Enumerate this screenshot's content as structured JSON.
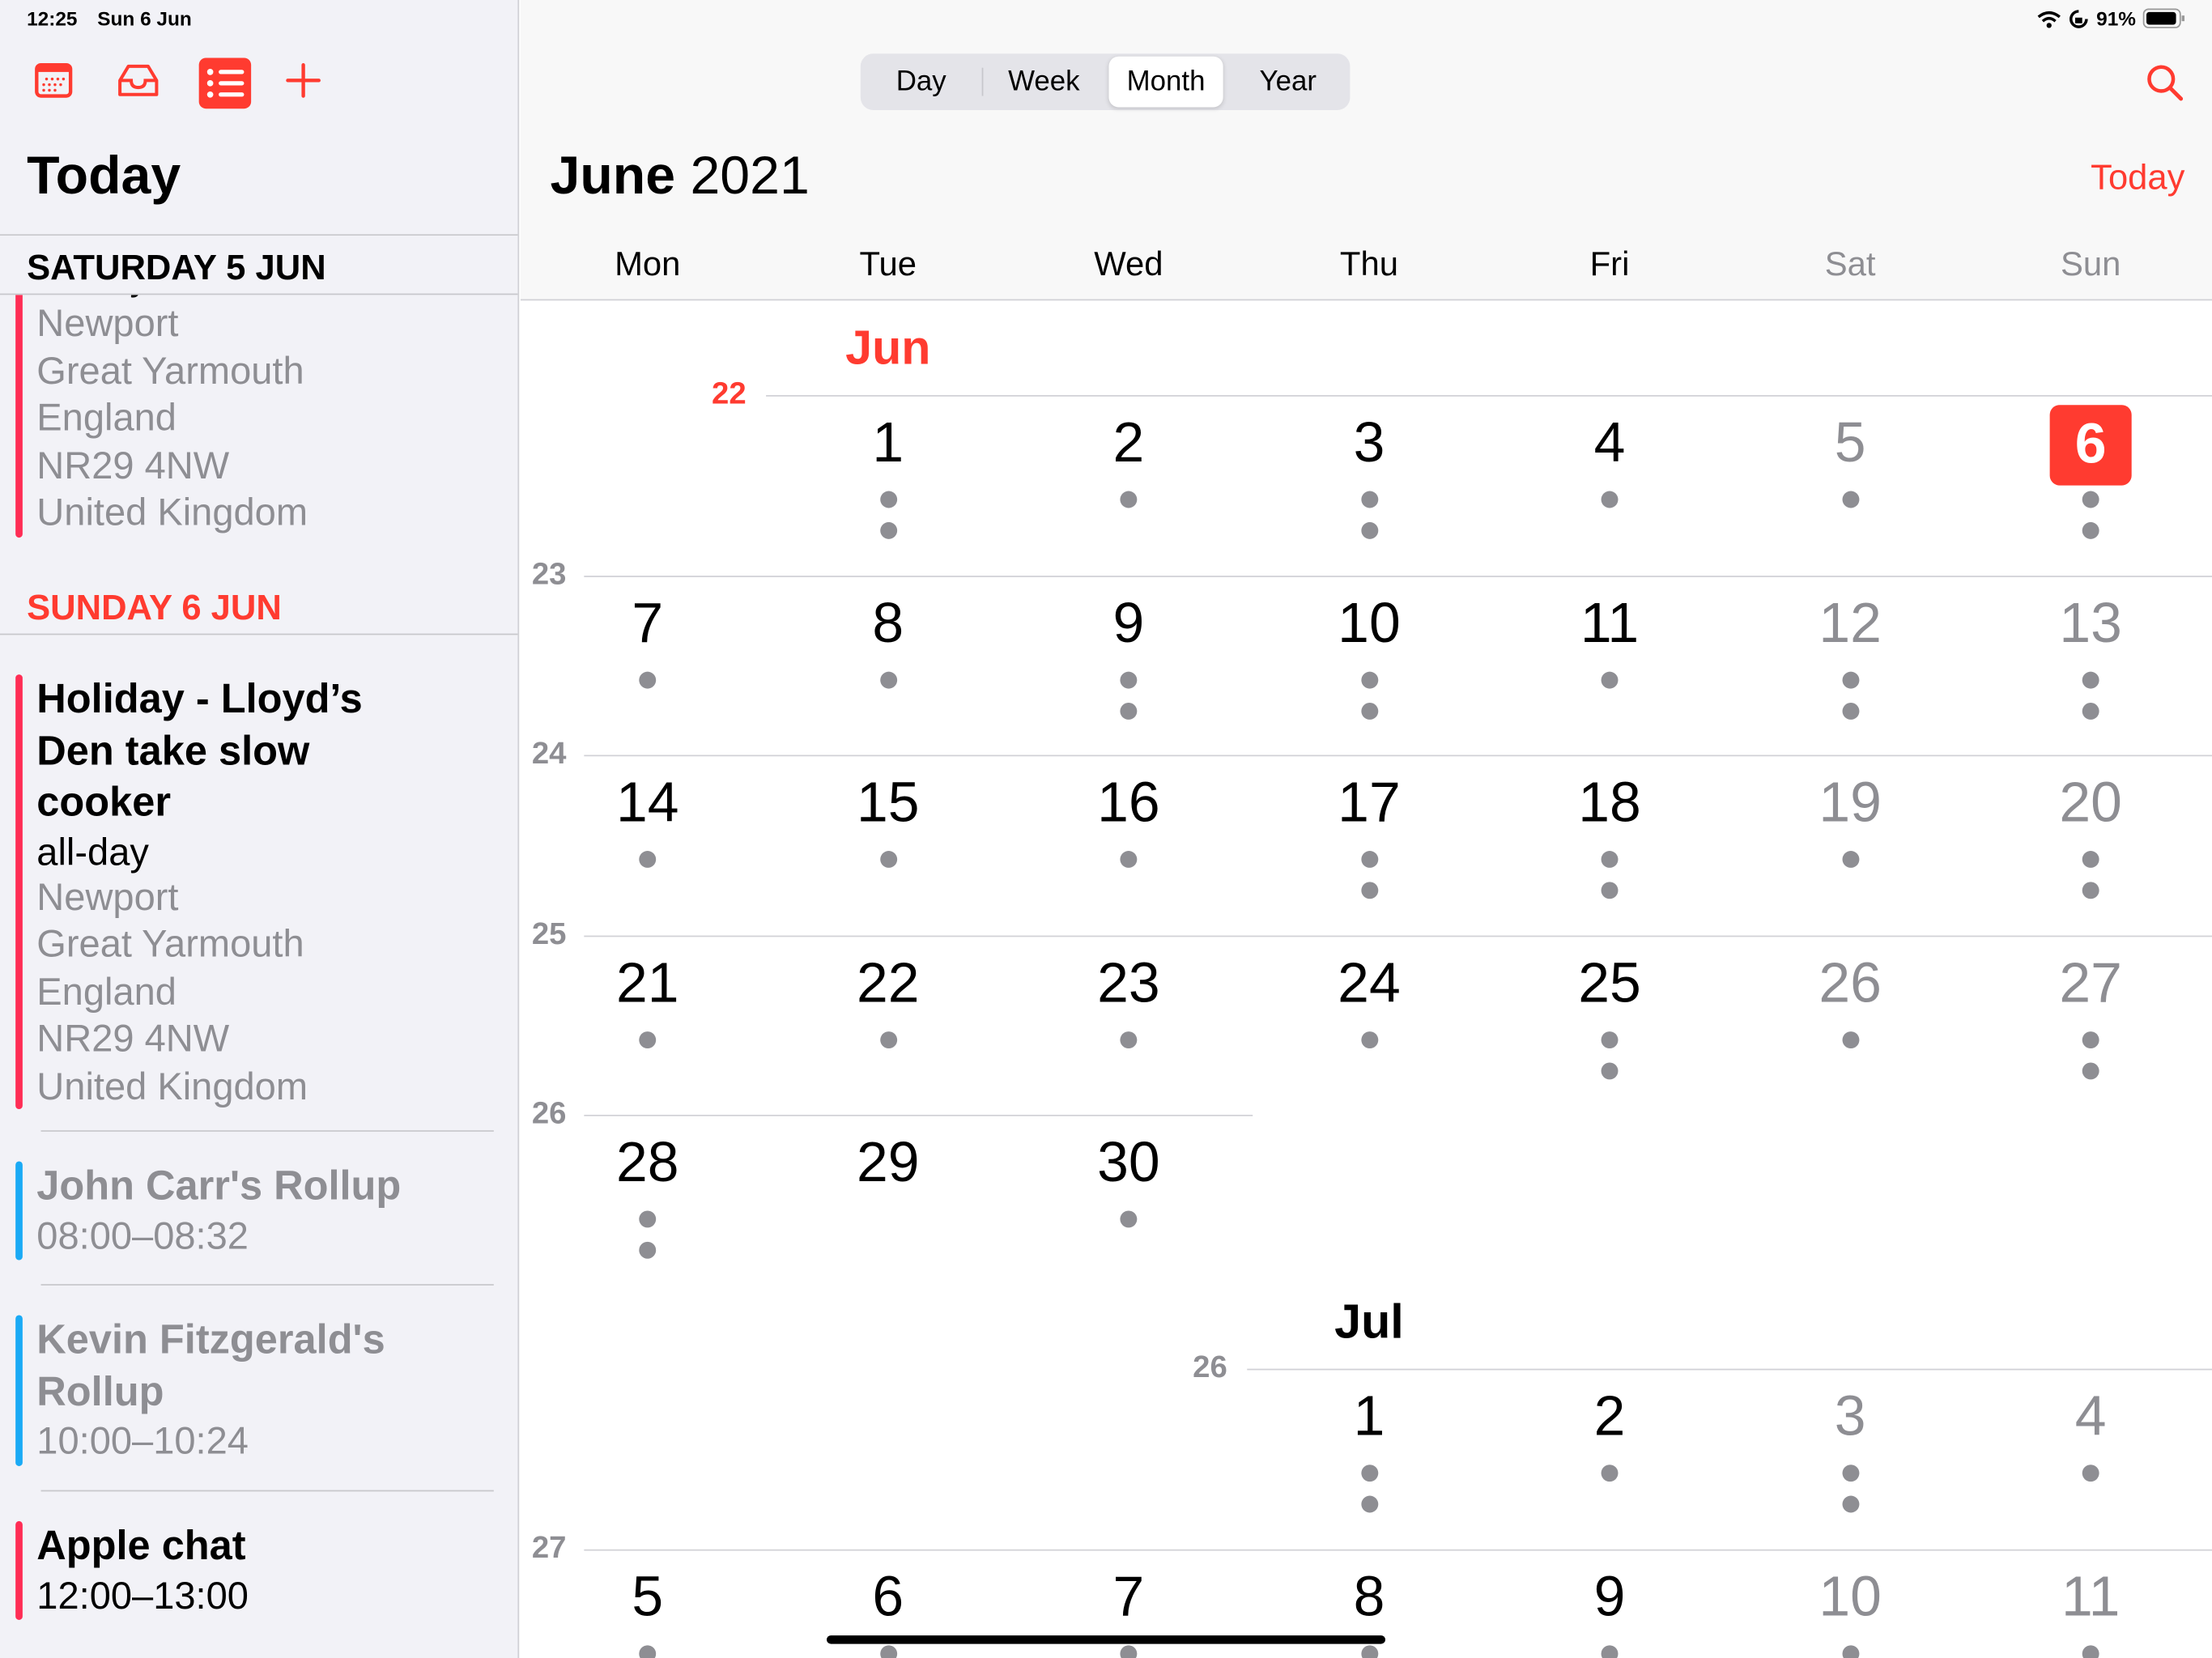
{
  "status_bar": {
    "time": "12:25",
    "date": "Sun 6 Jun",
    "battery": "91%",
    "icons": [
      "wifi-icon",
      "orientation-lock-icon",
      "battery-icon"
    ]
  },
  "sidebar": {
    "toolbar": [
      "calendar-icon",
      "inbox-icon",
      "list-icon",
      "add-icon"
    ],
    "title": "Today",
    "sections": [
      {
        "header": "SATURDAY 5 JUN",
        "events": [
          {
            "title": "",
            "lines": [
              "all-day"
            ],
            "location": [
              "Newport",
              "Great Yarmouth",
              "England",
              "NR29 4NW",
              "United Kingdom"
            ]
          }
        ]
      },
      {
        "header": "SUNDAY 6 JUN",
        "events": [
          {
            "title_lines": [
              "Holiday - Lloyd’s",
              "Den take slow",
              "cooker"
            ],
            "time": "all-day",
            "location": [
              "Newport",
              "Great Yarmouth",
              "England",
              "NR29 4NW",
              "United Kingdom"
            ]
          },
          {
            "title": "John Carr's Rollup",
            "time": "08:00–08:32"
          },
          {
            "title_lines": [
              "Kevin  Fitzgerald's",
              "Rollup"
            ],
            "time": "10:00–10:24"
          },
          {
            "title": "Apple chat",
            "time": "12:00–13:00"
          }
        ]
      }
    ]
  },
  "header": {
    "views": [
      "Day",
      "Week",
      "Month",
      "Year"
    ],
    "selected_view": "Month",
    "month": "June",
    "year": "2021",
    "today_button": "Today",
    "search_icon": "search-icon"
  },
  "weekdays": [
    "Mon",
    "Tue",
    "Wed",
    "Thu",
    "Fri",
    "Sat",
    "Sun"
  ],
  "calendar": {
    "jun_label": "Jun",
    "jul_label": "Jul",
    "today": 6,
    "june_weeks": [
      {
        "week": "22",
        "days": [
          null,
          1,
          2,
          3,
          4,
          5,
          6
        ],
        "dots": [
          0,
          2,
          1,
          2,
          1,
          1,
          2
        ]
      },
      {
        "week": "23",
        "days": [
          7,
          8,
          9,
          10,
          11,
          12,
          13
        ],
        "dots": [
          1,
          1,
          2,
          2,
          1,
          2,
          2
        ]
      },
      {
        "week": "24",
        "days": [
          14,
          15,
          16,
          17,
          18,
          19,
          20
        ],
        "dots": [
          1,
          1,
          1,
          2,
          2,
          1,
          2
        ]
      },
      {
        "week": "25",
        "days": [
          21,
          22,
          23,
          24,
          25,
          26,
          27
        ],
        "dots": [
          1,
          1,
          1,
          1,
          2,
          1,
          2
        ]
      },
      {
        "week": "26",
        "days": [
          28,
          29,
          30,
          null,
          null,
          null,
          null
        ],
        "dots": [
          2,
          0,
          1,
          0,
          0,
          0,
          0
        ]
      }
    ],
    "july_weeks": [
      {
        "week": "26",
        "days": [
          null,
          null,
          null,
          1,
          2,
          3,
          4
        ],
        "dots": [
          0,
          0,
          0,
          2,
          1,
          2,
          1
        ]
      },
      {
        "week": "27",
        "days": [
          5,
          6,
          7,
          8,
          9,
          10,
          11
        ],
        "dots": [
          1,
          1,
          1,
          1,
          1,
          1,
          1
        ]
      }
    ]
  },
  "colors": {
    "accent": "#ff3b30",
    "event_pink": "#ff2d55",
    "event_blue": "#1aaaf5",
    "muted": "#8e8e93"
  }
}
